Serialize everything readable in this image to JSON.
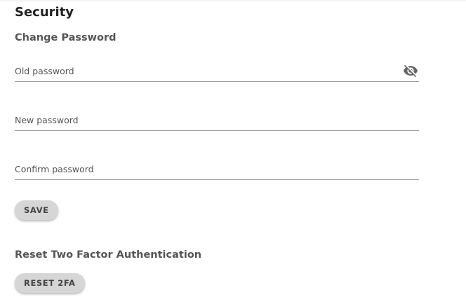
{
  "section": {
    "title": "Security"
  },
  "change_password": {
    "heading": "Change Password",
    "old_password": {
      "placeholder": "Old password",
      "value": ""
    },
    "new_password": {
      "placeholder": "New password",
      "value": ""
    },
    "confirm_password": {
      "placeholder": "Confirm password",
      "value": ""
    },
    "visibility_icon": "eye-off-icon",
    "save_label": "SAVE"
  },
  "two_factor": {
    "heading": "Reset Two Factor Authentication",
    "reset_label": "RESET 2FA"
  }
}
